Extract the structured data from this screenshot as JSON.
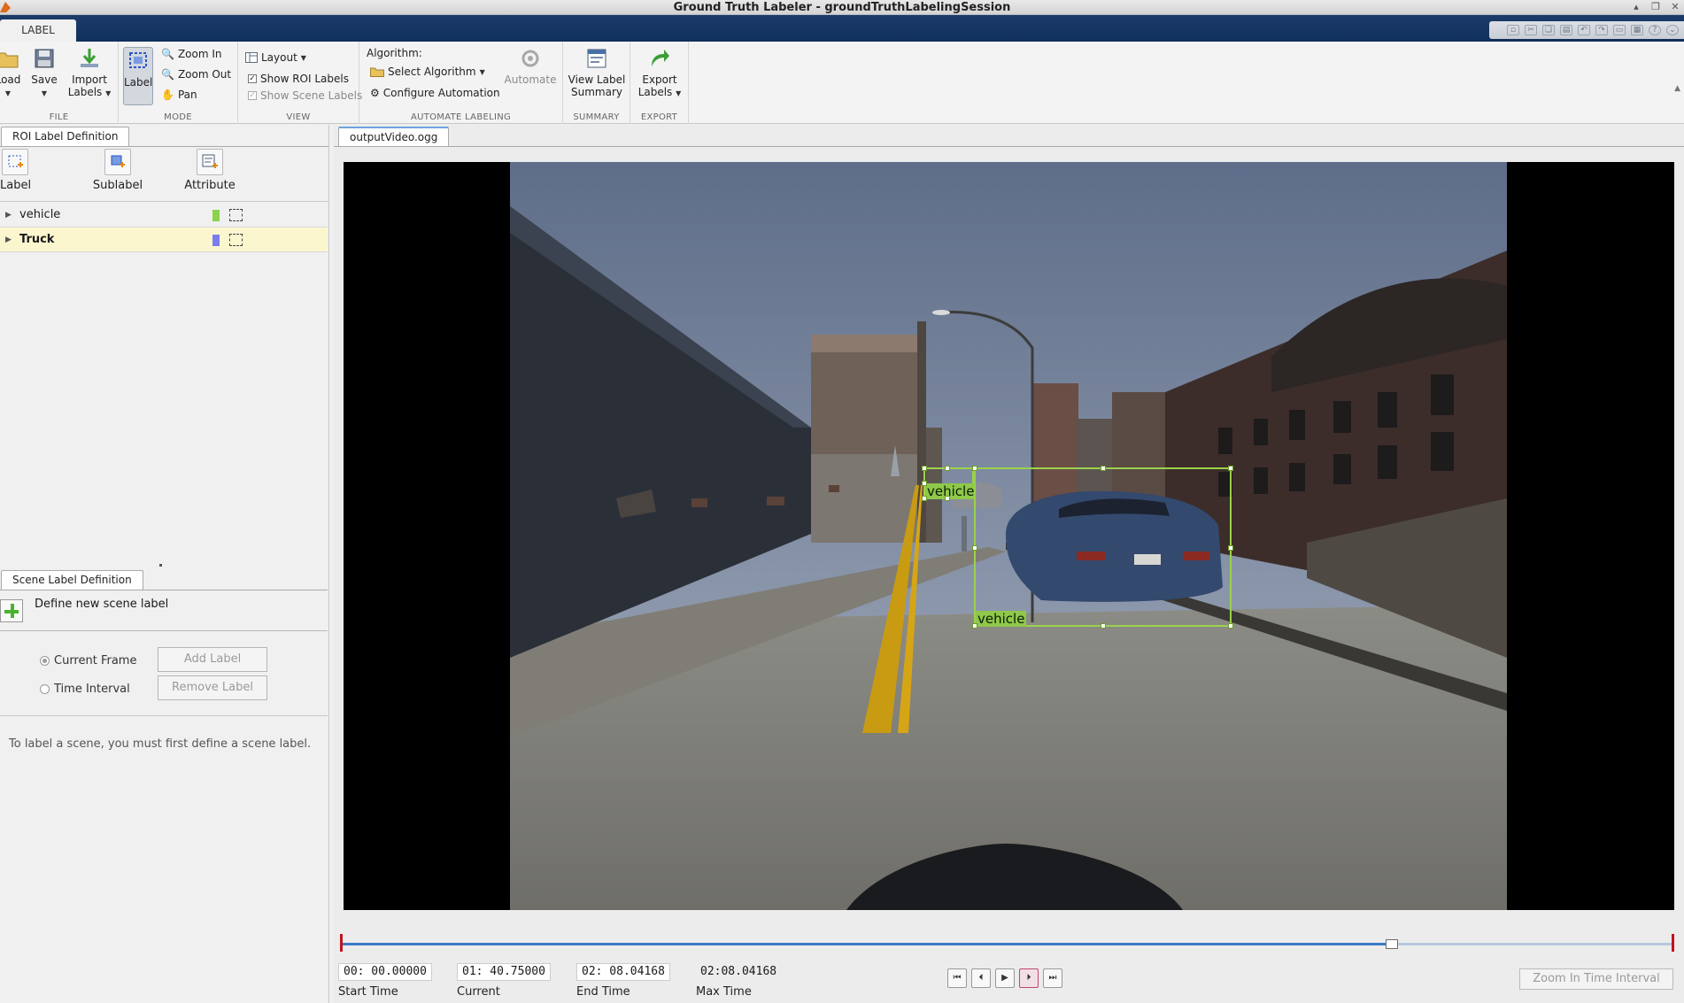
{
  "window": {
    "title": "Ground Truth Labeler - groundTruthLabelingSession"
  },
  "ribbon": {
    "tab": "LABEL",
    "file": {
      "section": "FILE",
      "load": "Load",
      "save": "Save",
      "import_line1": "Import",
      "import_line2": "Labels"
    },
    "mode": {
      "section": "MODE",
      "label": "Label",
      "zoom_in": "Zoom In",
      "zoom_out": "Zoom Out",
      "pan": "Pan"
    },
    "view": {
      "section": "VIEW",
      "layout": "Layout",
      "show_roi_labels": "Show ROI Labels",
      "show_scene_labels": "Show Scene Labels"
    },
    "automate": {
      "section": "AUTOMATE LABELING",
      "algorithm_caption": "Algorithm:",
      "select_algorithm": "Select Algorithm",
      "configure": "Configure Automation",
      "automate": "Automate"
    },
    "summary": {
      "section": "SUMMARY",
      "line1": "View Label",
      "line2": "Summary"
    },
    "export": {
      "section": "EXPORT",
      "line1": "Export",
      "line2": "Labels"
    }
  },
  "roi_panel": {
    "tab": "ROI Label Definition",
    "tools": [
      "Label",
      "Sublabel",
      "Attribute"
    ],
    "labels": [
      {
        "name": "vehicle",
        "color": "#8cd24a",
        "selected": false
      },
      {
        "name": "Truck",
        "color": "#7b7cf0",
        "selected": true
      }
    ]
  },
  "scene_panel": {
    "tab": "Scene Label Definition",
    "define": "Define new scene label",
    "current_frame": "Current Frame",
    "time_interval": "Time Interval",
    "add_label": "Add Label",
    "remove_label": "Remove Label",
    "hint": "To label a scene, you must first define a scene label."
  },
  "video": {
    "tab": "outputVideo.ogg",
    "boxes": [
      {
        "label": "vehicle"
      },
      {
        "label": "vehicle"
      }
    ]
  },
  "timeline": {
    "progress": 0.789,
    "start_time": "00: 00.00000",
    "start_caption": "Start Time",
    "current_time": "01: 40.75000",
    "current_caption": "Current",
    "end_time": "02: 08.04168",
    "end_caption": "End Time",
    "max_time": "02:08.04168",
    "max_caption": "Max Time",
    "zoom_interval": "Zoom In Time Interval"
  }
}
